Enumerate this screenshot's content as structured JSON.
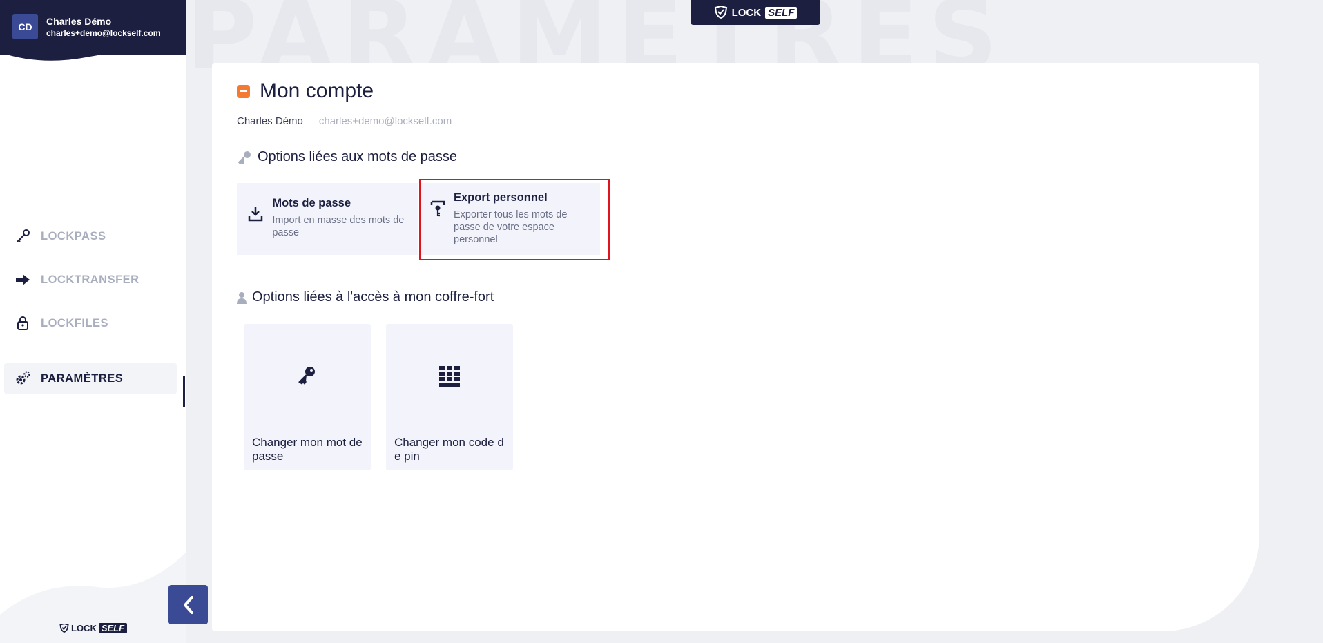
{
  "background_title": "PARAMÈTRES",
  "user": {
    "initials": "CD",
    "name": "Charles Démo",
    "email": "charles+demo@lockself.com"
  },
  "brand": {
    "lock": "LOCK",
    "self": "SELF"
  },
  "sidebar": {
    "items": [
      {
        "label": "LOCKPASS",
        "icon": "key-icon"
      },
      {
        "label": "LOCKTRANSFER",
        "icon": "arrow-right-icon"
      },
      {
        "label": "LOCKFILES",
        "icon": "lock-icon"
      },
      {
        "label": "PARAMÈTRES",
        "icon": "gears-icon",
        "active": true
      }
    ]
  },
  "main": {
    "title": "Mon compte",
    "user_name": "Charles Démo",
    "user_email": "charles+demo@lockself.com",
    "section_passwords": {
      "title": "Options liées aux mots de passe",
      "cards": [
        {
          "title": "Mots de passe",
          "desc": "Import en masse des mots de passe"
        },
        {
          "title": "Export personnel",
          "desc": "Exporter tous les mots de passe de votre espace personnel"
        }
      ]
    },
    "section_access": {
      "title": "Options liées à l'accès à mon coffre-fort",
      "tiles": [
        {
          "label": "Changer mon mot de passe"
        },
        {
          "label": "Changer mon code de pin"
        }
      ]
    }
  },
  "colors": {
    "navy": "#1c1f3f",
    "accent_blue": "#3a4a94",
    "orange": "#f47a33",
    "highlight_red": "#e0141e"
  }
}
